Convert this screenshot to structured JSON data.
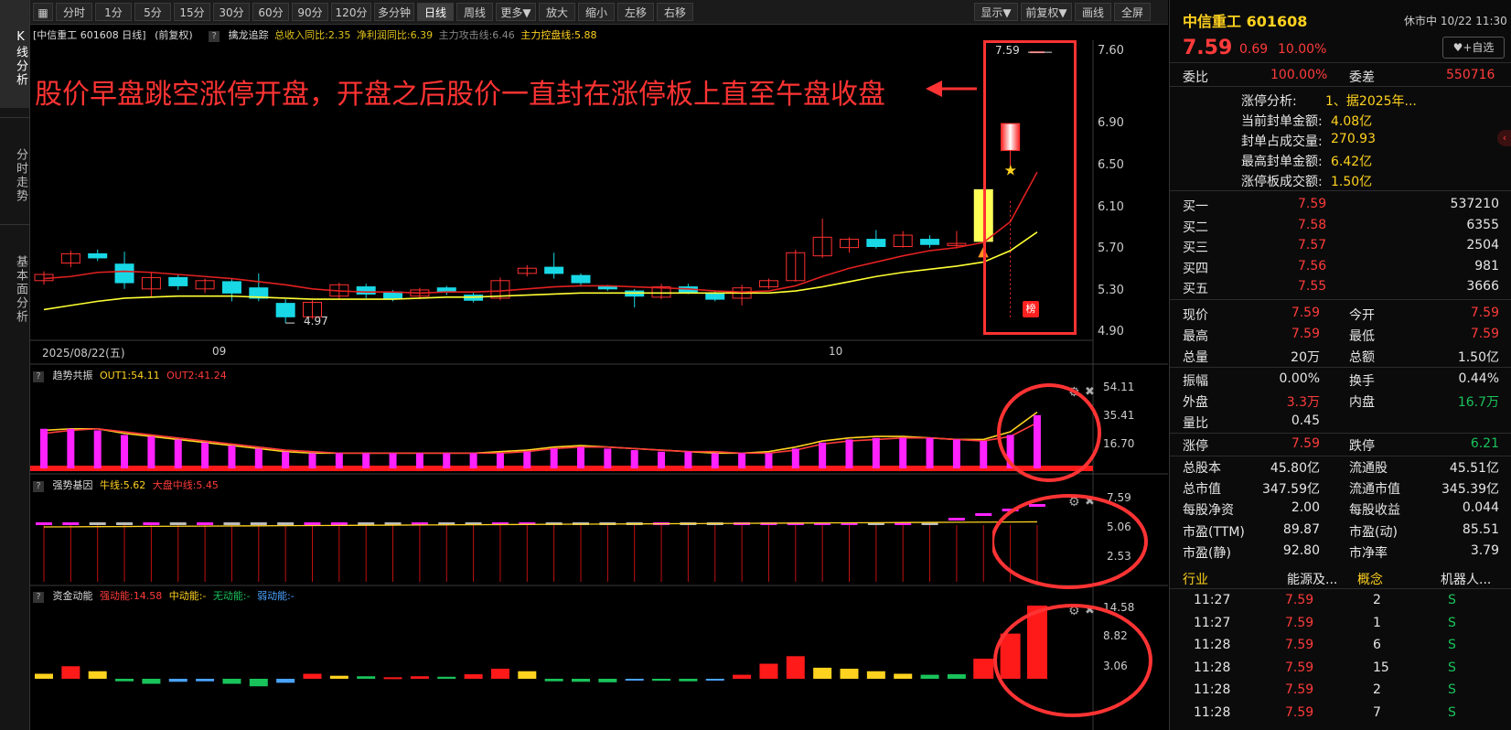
{
  "left_tabs": [
    "K线分析",
    "分时走势",
    "基本面分析"
  ],
  "toolbar": {
    "buttons": [
      "分时",
      "1分",
      "5分",
      "15分",
      "30分",
      "60分",
      "90分",
      "120分",
      "多分钟",
      "日线",
      "周线",
      "更多▼",
      "放大",
      "缩小",
      "左移",
      "右移"
    ],
    "active": "日线",
    "right_buttons": [
      "显示▼",
      "前复权▼",
      "画线",
      "全屏"
    ]
  },
  "main_chart": {
    "title": "[中信重工 601608 日线]",
    "adjust": "(前复权)",
    "indicator_name": "擒龙追踪",
    "indicator_values": [
      {
        "text": "总收入同比:2.35",
        "color": "#e0c21a"
      },
      {
        "text": "净利润同比:6.39",
        "color": "#e0c21a"
      },
      {
        "text": "主力攻击线:6.46",
        "color": "#888888"
      },
      {
        "text": "主力控盘线:5.88",
        "color": "#ffd21f"
      }
    ],
    "annotation": "股价早盘跳空涨停开盘，开盘之后股价一直封在涨停板上直至午盘收盘",
    "price_axis": [
      "7.60",
      "6.90",
      "6.50",
      "6.10",
      "5.70",
      "5.30",
      "4.90"
    ],
    "high_label": "7.59",
    "low_label": "4.97",
    "date_start": "2025/08/22(五)",
    "month_labels": [
      "09",
      "10"
    ],
    "badge": "榜"
  },
  "chart_data": [
    {
      "type": "candlestick",
      "title": "中信重工 601608 日线",
      "ylim": [
        4.9,
        7.6
      ],
      "candles": [
        {
          "o": 5.38,
          "c": 5.44,
          "h": 5.47,
          "l": 5.34
        },
        {
          "o": 5.55,
          "c": 5.64,
          "h": 5.67,
          "l": 5.51
        },
        {
          "o": 5.64,
          "c": 5.6,
          "h": 5.68,
          "l": 5.57
        },
        {
          "o": 5.54,
          "c": 5.36,
          "h": 5.66,
          "l": 5.3
        },
        {
          "o": 5.3,
          "c": 5.41,
          "h": 5.46,
          "l": 5.22
        },
        {
          "o": 5.41,
          "c": 5.33,
          "h": 5.44,
          "l": 5.29
        },
        {
          "o": 5.3,
          "c": 5.38,
          "h": 5.4,
          "l": 5.26
        },
        {
          "o": 5.37,
          "c": 5.26,
          "h": 5.4,
          "l": 5.18
        },
        {
          "o": 5.31,
          "c": 5.21,
          "h": 5.45,
          "l": 5.18
        },
        {
          "o": 5.16,
          "c": 5.03,
          "h": 5.2,
          "l": 4.97
        },
        {
          "o": 5.03,
          "c": 5.17,
          "h": 5.19,
          "l": 5.01
        },
        {
          "o": 5.23,
          "c": 5.34,
          "h": 5.36,
          "l": 5.2
        },
        {
          "o": 5.32,
          "c": 5.25,
          "h": 5.35,
          "l": 5.21
        },
        {
          "o": 5.27,
          "c": 5.21,
          "h": 5.29,
          "l": 5.18
        },
        {
          "o": 5.23,
          "c": 5.29,
          "h": 5.31,
          "l": 5.2
        },
        {
          "o": 5.31,
          "c": 5.27,
          "h": 5.33,
          "l": 5.24
        },
        {
          "o": 5.24,
          "c": 5.19,
          "h": 5.27,
          "l": 5.17
        },
        {
          "o": 5.21,
          "c": 5.38,
          "h": 5.41,
          "l": 5.19
        },
        {
          "o": 5.45,
          "c": 5.5,
          "h": 5.53,
          "l": 5.42
        },
        {
          "o": 5.51,
          "c": 5.45,
          "h": 5.65,
          "l": 5.4
        },
        {
          "o": 5.43,
          "c": 5.36,
          "h": 5.45,
          "l": 5.32
        },
        {
          "o": 5.33,
          "c": 5.3,
          "h": 5.34,
          "l": 5.28
        },
        {
          "o": 5.28,
          "c": 5.23,
          "h": 5.3,
          "l": 5.12
        },
        {
          "o": 5.22,
          "c": 5.32,
          "h": 5.35,
          "l": 5.2
        },
        {
          "o": 5.32,
          "c": 5.27,
          "h": 5.35,
          "l": 5.25
        },
        {
          "o": 5.25,
          "c": 5.2,
          "h": 5.28,
          "l": 5.18
        },
        {
          "o": 5.21,
          "c": 5.31,
          "h": 5.34,
          "l": 5.14
        },
        {
          "o": 5.32,
          "c": 5.38,
          "h": 5.4,
          "l": 5.3
        },
        {
          "o": 5.38,
          "c": 5.65,
          "h": 5.68,
          "l": 5.37
        },
        {
          "o": 5.62,
          "c": 5.8,
          "h": 5.98,
          "l": 5.6
        },
        {
          "o": 5.7,
          "c": 5.78,
          "h": 5.8,
          "l": 5.65
        },
        {
          "o": 5.78,
          "c": 5.71,
          "h": 5.87,
          "l": 5.69
        },
        {
          "o": 5.71,
          "c": 5.82,
          "h": 5.86,
          "l": 5.7
        },
        {
          "o": 5.78,
          "c": 5.73,
          "h": 5.82,
          "l": 5.7
        },
        {
          "o": 5.72,
          "c": 5.74,
          "h": 5.86,
          "l": 5.69
        },
        {
          "o": 5.76,
          "c": 6.26,
          "h": 6.27,
          "l": 5.72
        },
        {
          "o": 6.64,
          "c": 6.9,
          "h": 6.9,
          "l": 6.48
        },
        {
          "o": 7.59,
          "c": 7.59,
          "h": 7.59,
          "l": 7.59
        }
      ],
      "ma_red": [
        5.4,
        5.42,
        5.46,
        5.47,
        5.46,
        5.44,
        5.42,
        5.4,
        5.37,
        5.34,
        5.3,
        5.28,
        5.27,
        5.27,
        5.26,
        5.27,
        5.27,
        5.28,
        5.3,
        5.32,
        5.33,
        5.33,
        5.32,
        5.31,
        5.3,
        5.28,
        5.27,
        5.28,
        5.33,
        5.42,
        5.5,
        5.56,
        5.62,
        5.67,
        5.7,
        5.75,
        5.95,
        6.43
      ],
      "ma_yellow": [
        5.1,
        5.14,
        5.18,
        5.21,
        5.22,
        5.23,
        5.23,
        5.23,
        5.22,
        5.21,
        5.2,
        5.2,
        5.2,
        5.2,
        5.21,
        5.22,
        5.22,
        5.23,
        5.24,
        5.25,
        5.26,
        5.26,
        5.26,
        5.26,
        5.26,
        5.26,
        5.26,
        5.26,
        5.28,
        5.32,
        5.37,
        5.42,
        5.46,
        5.49,
        5.52,
        5.56,
        5.67,
        5.85
      ]
    },
    {
      "type": "bar",
      "title": "趋势共振",
      "ylim": [
        0,
        54.11
      ],
      "ticks": [
        "54.11",
        "35.41",
        "16.70"
      ],
      "series": [
        {
          "name": "OUT1:54.11",
          "color": "#ffd21f"
        },
        {
          "name": "OUT2:41.24",
          "color": "#ff3b3b"
        }
      ],
      "values": [
        26,
        26,
        25,
        22,
        21,
        19,
        17,
        15,
        13,
        11,
        10,
        10,
        10,
        10,
        10,
        10,
        10,
        10,
        11,
        13,
        14,
        13,
        12,
        11,
        11,
        10,
        10,
        10,
        13,
        17,
        19,
        20,
        20,
        20,
        19,
        18,
        22,
        35,
        54
      ],
      "out1": [
        25,
        26,
        26,
        23,
        21,
        19,
        17,
        15,
        13,
        11,
        10,
        10,
        10,
        10,
        10,
        10,
        10,
        11,
        12,
        14,
        15,
        14,
        13,
        12,
        11,
        10,
        10,
        11,
        14,
        18,
        20,
        21,
        21,
        20,
        19,
        19,
        24,
        37,
        54.11
      ],
      "out2": [
        23,
        25,
        26,
        24,
        22,
        20,
        18,
        16,
        14,
        12,
        11,
        10,
        10,
        10,
        10,
        10,
        10,
        10,
        11,
        13,
        14,
        14,
        13,
        12,
        11,
        11,
        10,
        10,
        12,
        16,
        18,
        19,
        20,
        20,
        19,
        18,
        21,
        30,
        41.24
      ]
    },
    {
      "type": "bar",
      "title": "强势基因",
      "ylim": [
        0,
        7.59
      ],
      "ticks": [
        "7.59",
        "5.06",
        "2.53"
      ],
      "series": [
        {
          "name": "牛线:5.62",
          "color": "#ffd21f"
        },
        {
          "name": "大盘中线:5.45",
          "color": "#ff3b3b"
        }
      ]
    },
    {
      "type": "bar",
      "title": "资金动能",
      "ylim": [
        0,
        14.58
      ],
      "ticks": [
        "14.58",
        "8.82",
        "3.06"
      ],
      "series": [
        {
          "name": "强动能:14.58",
          "color": "#ff3b3b"
        },
        {
          "name": "中动能:-",
          "color": "#ffd21f"
        },
        {
          "name": "无动能:-",
          "color": "#19c35b"
        },
        {
          "name": "弱动能:-",
          "color": "#4aa3ff"
        }
      ],
      "values": [
        1,
        2.5,
        1.5,
        -0.5,
        -1,
        -0.6,
        -0.5,
        -1,
        -1.5,
        -0.8,
        1,
        0.6,
        0.5,
        0.3,
        0.5,
        0.4,
        0.9,
        2,
        1.5,
        -0.5,
        -0.6,
        -0.7,
        -0.3,
        -0.4,
        -0.5,
        -0.3,
        0.8,
        3,
        4.5,
        2.2,
        2,
        1.5,
        1,
        0.8,
        0.9,
        4,
        9,
        14.58
      ],
      "colors": [
        "#ffd21f",
        "#ff1a1a",
        "#ffd21f",
        "#19c35b",
        "#19c35b",
        "#4aa3ff",
        "#4aa3ff",
        "#19c35b",
        "#19c35b",
        "#4aa3ff",
        "#ff1a1a",
        "#ffd21f",
        "#19c35b",
        "#ff1a1a",
        "#ff1a1a",
        "#19c35b",
        "#ff1a1a",
        "#ff1a1a",
        "#ffd21f",
        "#19c35b",
        "#19c35b",
        "#19c35b",
        "#4aa3ff",
        "#19c35b",
        "#19c35b",
        "#4aa3ff",
        "#ff1a1a",
        "#ff1a1a",
        "#ff1a1a",
        "#ffd21f",
        "#ffd21f",
        "#ffd21f",
        "#ffd21f",
        "#19c35b",
        "#19c35b",
        "#ff1a1a",
        "#ff1a1a",
        "#ff1a1a"
      ]
    }
  ],
  "right_panel": {
    "name": "中信重工 601608",
    "status": "休市中 10/22 11:30",
    "price": "7.59",
    "change": "0.69",
    "pct": "10.00%",
    "fav_button": "+自选",
    "weibi_label": "委比",
    "weibi": "100.00%",
    "weicha_label": "委差",
    "weicha": "550716",
    "limit_analysis": [
      {
        "label": "涨停分析:",
        "value": "1、据2025年..."
      },
      {
        "label": "当前封单金额:",
        "value": "4.08亿"
      },
      {
        "label": "封单占成交量:",
        "value": "270.93"
      },
      {
        "label": "最高封单金额:",
        "value": "6.42亿"
      },
      {
        "label": "涨停板成交额:",
        "value": "1.50亿"
      }
    ],
    "bids": [
      {
        "label": "买一",
        "price": "7.59",
        "vol": "537210"
      },
      {
        "label": "买二",
        "price": "7.58",
        "vol": "6355"
      },
      {
        "label": "买三",
        "price": "7.57",
        "vol": "2504"
      },
      {
        "label": "买四",
        "price": "7.56",
        "vol": "981"
      },
      {
        "label": "买五",
        "price": "7.55",
        "vol": "3666"
      }
    ],
    "stats": [
      [
        {
          "label": "现价",
          "value": "7.59",
          "color": "red"
        },
        {
          "label": "今开",
          "value": "7.59",
          "color": "red"
        }
      ],
      [
        {
          "label": "最高",
          "value": "7.59",
          "color": "red"
        },
        {
          "label": "最低",
          "value": "7.59",
          "color": "red"
        }
      ],
      [
        {
          "label": "总量",
          "value": "20万",
          "color": "white"
        },
        {
          "label": "总额",
          "value": "1.50亿",
          "color": "white"
        }
      ],
      [
        {
          "label": "振幅",
          "value": "0.00%",
          "color": "white"
        },
        {
          "label": "换手",
          "value": "0.44%",
          "color": "white"
        }
      ],
      [
        {
          "label": "外盘",
          "value": "3.3万",
          "color": "red"
        },
        {
          "label": "内盘",
          "value": "16.7万",
          "color": "green"
        }
      ],
      [
        {
          "label": "量比",
          "value": "0.45",
          "color": "white"
        },
        {
          "label": "",
          "value": "",
          "color": "white"
        }
      ],
      [
        {
          "label": "涨停",
          "value": "7.59",
          "color": "red"
        },
        {
          "label": "跌停",
          "value": "6.21",
          "color": "green"
        }
      ],
      [
        {
          "label": "总股本",
          "value": "45.80亿",
          "color": "white"
        },
        {
          "label": "流通股",
          "value": "45.51亿",
          "color": "white"
        }
      ],
      [
        {
          "label": "总市值",
          "value": "347.59亿",
          "color": "white"
        },
        {
          "label": "流通市值",
          "value": "345.39亿",
          "color": "white"
        }
      ],
      [
        {
          "label": "每股净资",
          "value": "2.00",
          "color": "white"
        },
        {
          "label": "每股收益",
          "value": "0.044",
          "color": "white"
        }
      ],
      [
        {
          "label": "市盈(TTM)",
          "value": "89.87",
          "color": "white"
        },
        {
          "label": "市盈(动)",
          "value": "85.51",
          "color": "white"
        }
      ],
      [
        {
          "label": "市盈(静)",
          "value": "92.80",
          "color": "white"
        },
        {
          "label": "市净率",
          "value": "3.79",
          "color": "white"
        }
      ]
    ],
    "industry_label": "行业",
    "industry": "能源及...",
    "concept_label": "概念",
    "concept": "机器人...",
    "ticks": [
      {
        "time": "11:27",
        "price": "7.59",
        "vol": "2",
        "side": "S"
      },
      {
        "time": "11:27",
        "price": "7.59",
        "vol": "1",
        "side": "S"
      },
      {
        "time": "11:28",
        "price": "7.59",
        "vol": "6",
        "side": "S"
      },
      {
        "time": "11:28",
        "price": "7.59",
        "vol": "15",
        "side": "S"
      },
      {
        "time": "11:28",
        "price": "7.59",
        "vol": "2",
        "side": "S"
      },
      {
        "time": "11:28",
        "price": "7.59",
        "vol": "7",
        "side": "S"
      }
    ]
  }
}
